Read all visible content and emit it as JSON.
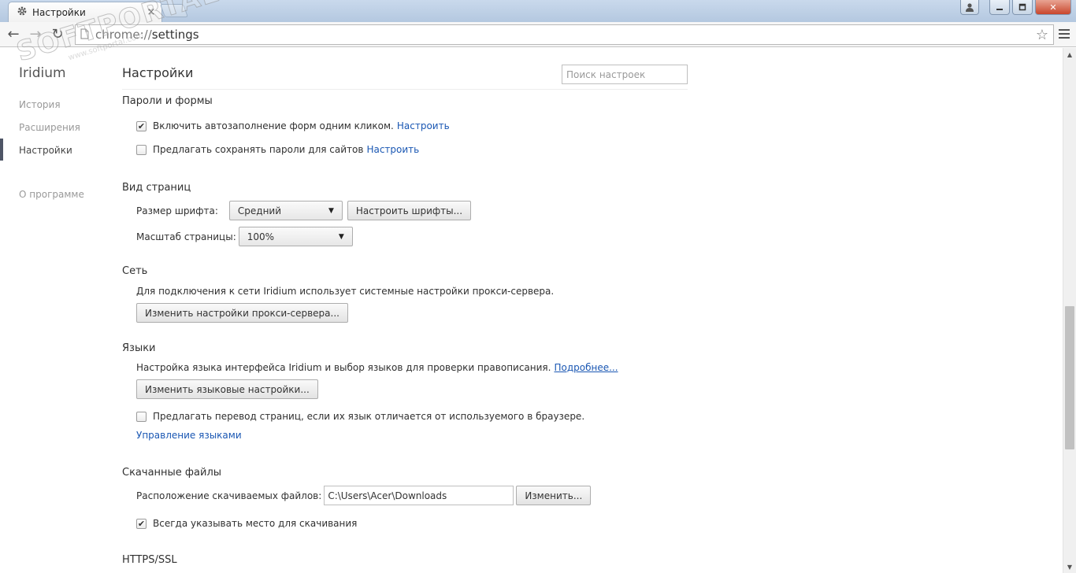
{
  "window": {
    "tab_title": "Настройки",
    "tab_close": "×",
    "controls": {
      "minimize": "—",
      "maximize": "❐",
      "close": "✕",
      "user": "👤"
    }
  },
  "toolbar": {
    "url_prefix": "chrome://",
    "url_path": "settings",
    "back": "←",
    "forward": "→",
    "reload": "↻",
    "star": "☆"
  },
  "sidebar": {
    "brand": "Iridium",
    "items": [
      {
        "label": "История"
      },
      {
        "label": "Расширения"
      },
      {
        "label": "Настройки",
        "active": true
      },
      {
        "label": "О программе"
      }
    ]
  },
  "watermark": {
    "big": "SOFTPORTAL",
    "small": "www.softportal.com"
  },
  "main": {
    "title": "Настройки",
    "search_placeholder": "Поиск настроек",
    "passwords": {
      "title": "Пароли и формы",
      "autofill_label": "Включить автозаполнение форм одним кликом.",
      "autofill_checked": true,
      "autofill_link": "Настроить",
      "save_passwords_label": "Предлагать сохранять пароли для сайтов",
      "save_passwords_checked": false,
      "save_passwords_link": "Настроить"
    },
    "appearance": {
      "title": "Вид страниц",
      "font_size_label": "Размер шрифта:",
      "font_size_value": "Средний",
      "customize_fonts_button": "Настроить шрифты...",
      "zoom_label": "Масштаб страницы:",
      "zoom_value": "100%"
    },
    "network": {
      "title": "Сеть",
      "description": "Для подключения к сети Iridium использует системные настройки прокси-сервера.",
      "proxy_button": "Изменить настройки прокси-сервера..."
    },
    "languages": {
      "title": "Языки",
      "description": "Настройка языка интерфейса Iridium и выбор языков для проверки правописания.",
      "more_link": "Подробнее...",
      "language_settings_button": "Изменить языковые настройки...",
      "translate_label": "Предлагать перевод страниц, если их язык отличается от используемого в браузере.",
      "translate_checked": false,
      "manage_languages_link": "Управление языками"
    },
    "downloads": {
      "title": "Скачанные файлы",
      "location_label": "Расположение скачиваемых файлов:",
      "location_value": "C:\\Users\\Acer\\Downloads",
      "change_button": "Изменить...",
      "ask_location_label": "Всегда указывать место для скачивания",
      "ask_location_checked": true
    },
    "https": {
      "title": "HTTPS/SSL"
    }
  },
  "scrollbar": {
    "up": "▲",
    "down": "▼"
  }
}
